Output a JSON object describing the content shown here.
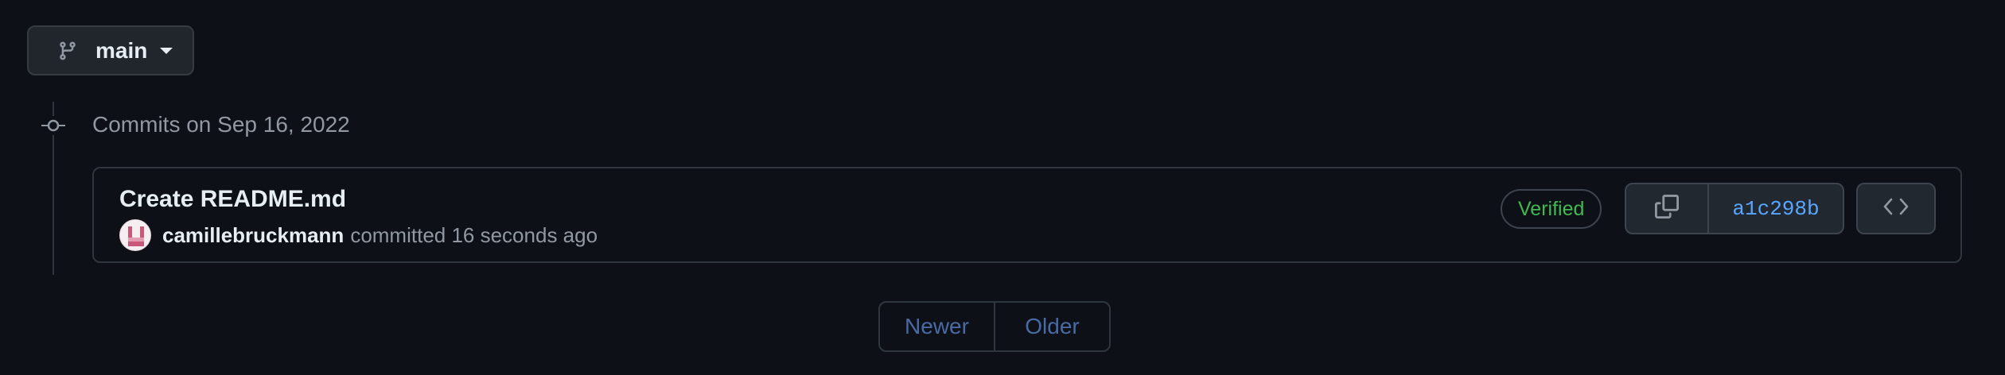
{
  "branch_selector": {
    "label": "main",
    "icon": "git-branch-icon"
  },
  "commit_group": {
    "heading": "Commits on Sep 16, 2022",
    "icon": "git-commit-icon"
  },
  "commit": {
    "title": "Create README.md",
    "author": "camillebruckmann",
    "committed_text": "committed 16 seconds ago",
    "verified_label": "Verified",
    "sha": "a1c298b",
    "copy_icon": "copy-icon",
    "browse_icon": "code-icon"
  },
  "pagination": {
    "newer_label": "Newer",
    "older_label": "Older"
  },
  "colors": {
    "background": "#0d1117",
    "verified": "#3fb950",
    "sha_link": "#58a6ff",
    "pagination_disabled": "#4a6aa6"
  }
}
